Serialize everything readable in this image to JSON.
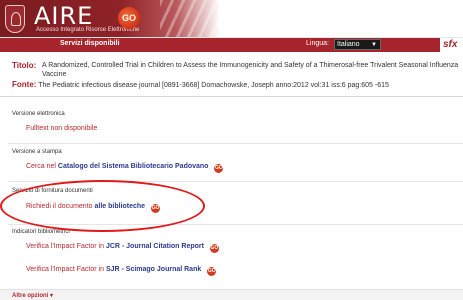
{
  "header": {
    "logo_text": "AIRE",
    "logo_subtitle": "Accesso Integrato Risorse Elettroniche",
    "logo_go": "GO",
    "sfx_logo": "sfx"
  },
  "menubar": {
    "service_label": "Servizi disponibili",
    "language_label": "Lingua:",
    "language_value": "Italiano"
  },
  "citation": {
    "title_label": "Titolo:",
    "title": "A Randomized, Controlled Trial in Children to Assess the Immunogenicity and Safety of a Thimerosal-free Trivalent Seasonal Influenza Vaccine",
    "source_label": "Fonte:",
    "source": "The Pediatric infectious disease journal [0891-3668] Domachowske, Joseph anno:2012 vol:31 iss:6 pag:605 -615"
  },
  "sections": {
    "electronic": {
      "heading": "Versione elettronica",
      "link": "Fulltext non disponibile"
    },
    "print": {
      "heading": "Versione a stampa",
      "link_prefix": "Cerca nel",
      "link_bold": "Catalogo del Sistema Bibliotecario Padovano",
      "icon": "GO"
    },
    "document_supply": {
      "heading": "Servizio di fornitura documenti",
      "link_prefix": "Richiedi il documento",
      "link_bold": "alle biblioteche",
      "icon": "GO"
    },
    "bibliometric": {
      "heading": "Indicatori bibliometrici",
      "jcr_prefix": "Verifica l'Impact Factor in",
      "jcr_bold": "JCR - Journal Citation Report",
      "sjr_prefix": "Verifica l'Impact Factor in",
      "sjr_bold": "SJR - Scimago Journal Rank",
      "icon": "GO"
    }
  },
  "footer": {
    "more_options": "Altre opzioni ▾"
  },
  "colors": {
    "brand_red": "#a6242b",
    "link_red": "#b5282e",
    "link_blue": "#2b3b8c",
    "annotation_red": "#e01a1a"
  }
}
